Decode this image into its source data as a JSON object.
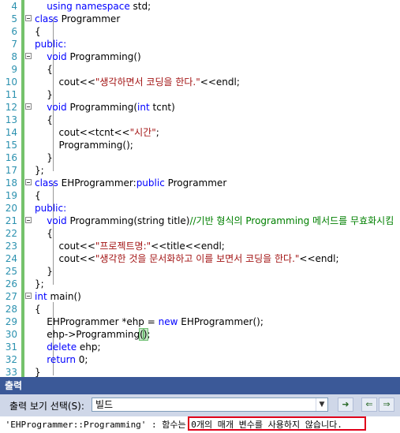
{
  "editor": {
    "lines": [
      {
        "n": "4",
        "parts": [
          {
            "t": "    "
          },
          {
            "t": "using namespace",
            "c": "kw"
          },
          {
            "t": " std;"
          }
        ]
      },
      {
        "n": "5",
        "parts": [
          {
            "t": "class",
            "c": "kw"
          },
          {
            "t": " Programmer"
          }
        ]
      },
      {
        "n": "6",
        "parts": [
          {
            "t": "{"
          }
        ]
      },
      {
        "n": "7",
        "parts": [
          {
            "t": "public:",
            "c": "kw"
          }
        ]
      },
      {
        "n": "8",
        "parts": [
          {
            "t": "    "
          },
          {
            "t": "void",
            "c": "kw"
          },
          {
            "t": " Programming()"
          }
        ]
      },
      {
        "n": "9",
        "parts": [
          {
            "t": "    {"
          }
        ]
      },
      {
        "n": "10",
        "parts": [
          {
            "t": "        cout<<"
          },
          {
            "t": "\"생각하면서 코딩을 한다.\"",
            "c": "str"
          },
          {
            "t": "<<endl;"
          }
        ]
      },
      {
        "n": "11",
        "parts": [
          {
            "t": "    }"
          }
        ]
      },
      {
        "n": "12",
        "parts": [
          {
            "t": "    "
          },
          {
            "t": "void",
            "c": "kw"
          },
          {
            "t": " Programming("
          },
          {
            "t": "int",
            "c": "kw"
          },
          {
            "t": " tcnt)"
          }
        ]
      },
      {
        "n": "13",
        "parts": [
          {
            "t": "    {"
          }
        ]
      },
      {
        "n": "14",
        "parts": [
          {
            "t": "        cout<<tcnt<<"
          },
          {
            "t": "\"시간\"",
            "c": "str"
          },
          {
            "t": ";"
          }
        ]
      },
      {
        "n": "15",
        "parts": [
          {
            "t": "        Programming();"
          }
        ]
      },
      {
        "n": "16",
        "parts": [
          {
            "t": "    }"
          }
        ]
      },
      {
        "n": "17",
        "parts": [
          {
            "t": "};"
          }
        ]
      },
      {
        "n": "18",
        "parts": [
          {
            "t": "class",
            "c": "kw"
          },
          {
            "t": " EHProgrammer:"
          },
          {
            "t": "public",
            "c": "kw"
          },
          {
            "t": " Programmer"
          }
        ]
      },
      {
        "n": "19",
        "parts": [
          {
            "t": "{"
          }
        ]
      },
      {
        "n": "20",
        "parts": [
          {
            "t": "public:",
            "c": "kw"
          }
        ]
      },
      {
        "n": "21",
        "parts": [
          {
            "t": "    "
          },
          {
            "t": "void",
            "c": "kw"
          },
          {
            "t": " Programming(string title)"
          },
          {
            "t": "//기반 형식의 Programming 메서드를 무효화시킴",
            "c": "cmt"
          }
        ]
      },
      {
        "n": "22",
        "parts": [
          {
            "t": "    {"
          }
        ]
      },
      {
        "n": "23",
        "parts": [
          {
            "t": "        cout<<"
          },
          {
            "t": "\"프로젝트명:\"",
            "c": "str"
          },
          {
            "t": "<<title<<endl;"
          }
        ]
      },
      {
        "n": "24",
        "parts": [
          {
            "t": "        cout<<"
          },
          {
            "t": "\"생각한 것을 문서화하고 이를 보면서 코딩을 한다.\"",
            "c": "str"
          },
          {
            "t": "<<endl;"
          }
        ]
      },
      {
        "n": "25",
        "parts": [
          {
            "t": "    }"
          }
        ]
      },
      {
        "n": "26",
        "parts": [
          {
            "t": "};"
          }
        ]
      },
      {
        "n": "27",
        "parts": [
          {
            "t": "int",
            "c": "kw"
          },
          {
            "t": " main()"
          }
        ]
      },
      {
        "n": "28",
        "parts": [
          {
            "t": "{"
          }
        ]
      },
      {
        "n": "29",
        "parts": [
          {
            "t": "    EHProgrammer *ehp = "
          },
          {
            "t": "new",
            "c": "kw"
          },
          {
            "t": " EHProgrammer();"
          }
        ]
      },
      {
        "n": "30",
        "parts": [
          {
            "t": "    ehp->Programming"
          },
          {
            "t": "(",
            "c": "hl"
          },
          {
            "t": ")",
            "c": "hl"
          },
          {
            "t": ";"
          }
        ]
      },
      {
        "n": "31",
        "parts": [
          {
            "t": "    "
          },
          {
            "t": "delete",
            "c": "kw"
          },
          {
            "t": " ehp;"
          }
        ]
      },
      {
        "n": "32",
        "parts": [
          {
            "t": "    "
          },
          {
            "t": "return",
            "c": "kw"
          },
          {
            "t": " 0;"
          }
        ]
      },
      {
        "n": "33",
        "parts": [
          {
            "t": "}"
          }
        ]
      }
    ]
  },
  "output": {
    "title": "출력",
    "view_label": "출력 보기 선택(S):",
    "view_value": "빌드",
    "message_prefix": " 'EHProgrammer::Programming' : 함수는 ",
    "message_highlight": "0개의 매개 변수를 사용하지 않습니다."
  }
}
